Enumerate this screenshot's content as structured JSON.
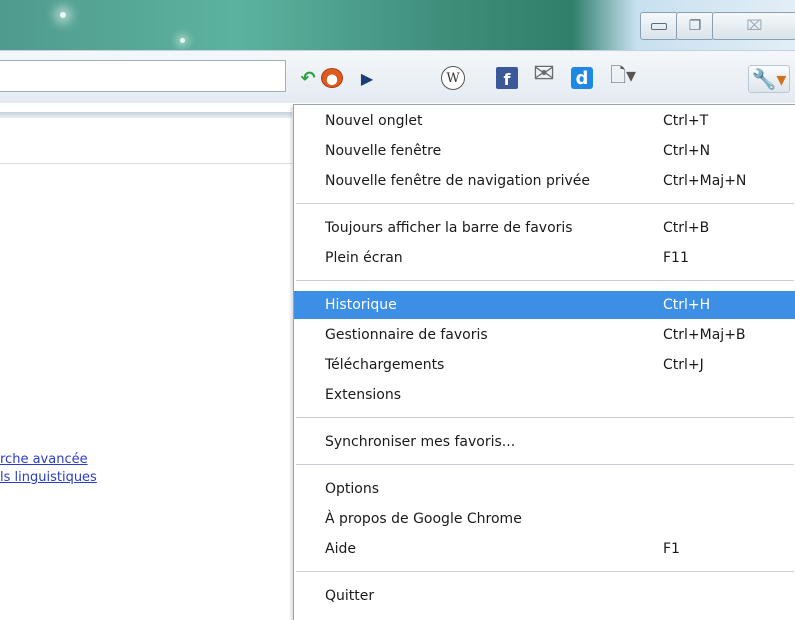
{
  "window": {
    "controls": [
      "minimize",
      "restore",
      "close"
    ],
    "close_glyph": "⌧"
  },
  "toolbar": {
    "icons": [
      "back-arrow-icon",
      "fox-extension-icon",
      "play-icon",
      "wikipedia-icon",
      "facebook-icon",
      "gmail-icon",
      "d-extension-icon",
      "page-menu-icon",
      "wrench-menu-icon"
    ],
    "wiki_letter": "W",
    "fb_letter": "f",
    "d_letter": "d"
  },
  "page": {
    "links": [
      "rche avancée",
      "ls linguistiques"
    ]
  },
  "menu": {
    "groups": [
      [
        {
          "label": "Nouvel onglet",
          "shortcut": "Ctrl+T"
        },
        {
          "label": "Nouvelle fenêtre",
          "shortcut": "Ctrl+N"
        },
        {
          "label": "Nouvelle fenêtre de navigation privée",
          "shortcut": "Ctrl+Maj+N"
        }
      ],
      [
        {
          "label": "Toujours afficher la barre de favoris",
          "shortcut": "Ctrl+B"
        },
        {
          "label": "Plein écran",
          "shortcut": "F11"
        }
      ],
      [
        {
          "label": "Historique",
          "shortcut": "Ctrl+H",
          "highlighted": true
        },
        {
          "label": "Gestionnaire de favoris",
          "shortcut": "Ctrl+Maj+B"
        },
        {
          "label": "Téléchargements",
          "shortcut": "Ctrl+J"
        },
        {
          "label": "Extensions",
          "shortcut": ""
        }
      ],
      [
        {
          "label": "Synchroniser mes favoris...",
          "shortcut": ""
        }
      ],
      [
        {
          "label": "Options",
          "shortcut": ""
        },
        {
          "label": "À propos de Google Chrome",
          "shortcut": ""
        },
        {
          "label": "Aide",
          "shortcut": "F1"
        }
      ],
      [
        {
          "label": "Quitter",
          "shortcut": ""
        }
      ]
    ],
    "highlight_color": "#3d8ee5"
  }
}
